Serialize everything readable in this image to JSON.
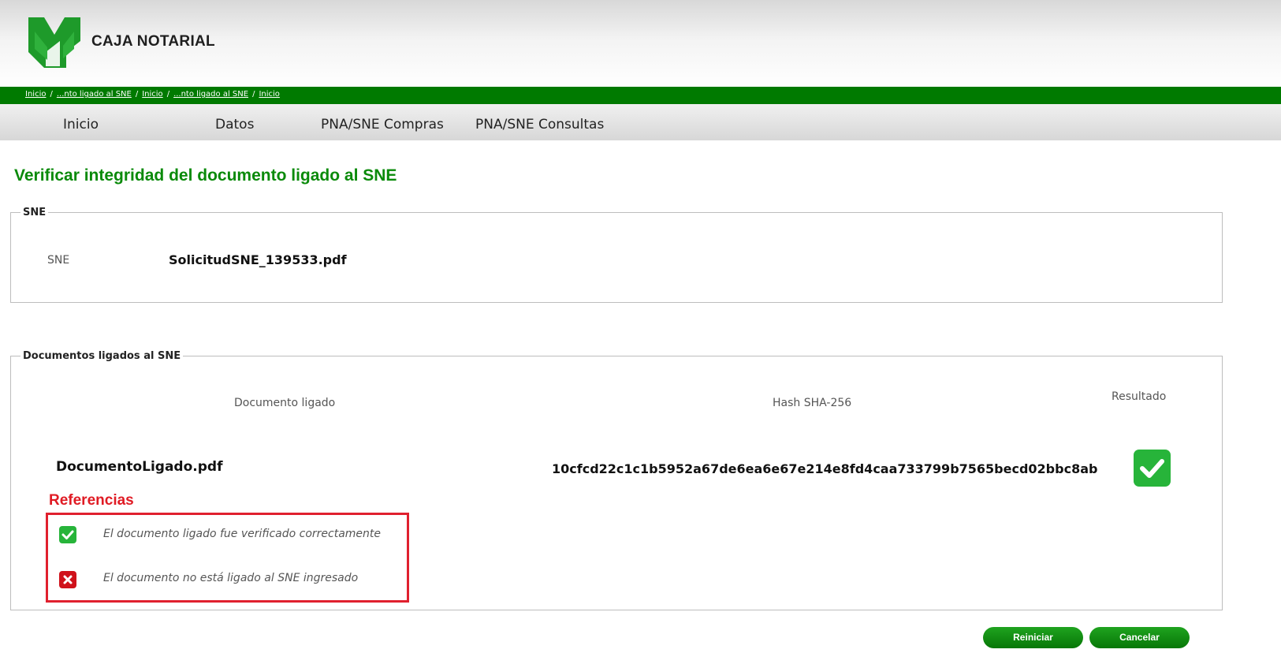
{
  "brand": {
    "name": "CAJA NOTARIAL",
    "logo_icon": "caja-notarial-logo",
    "color": "#0a8a0a"
  },
  "breadcrumb": [
    {
      "label": "Inicio"
    },
    {
      "label": "...nto ligado al SNE"
    },
    {
      "label": "Inicio"
    },
    {
      "label": "...nto ligado al SNE"
    },
    {
      "label": "Inicio"
    }
  ],
  "breadcrumb_separator": "/",
  "nav": [
    {
      "label": "Inicio"
    },
    {
      "label": "Datos"
    },
    {
      "label": "PNA/SNE Compras"
    },
    {
      "label": "PNA/SNE Consultas"
    }
  ],
  "page_title": "Verificar integridad del documento ligado al SNE",
  "sne_section": {
    "legend": "SNE",
    "label": "SNE",
    "value": "SolicitudSNE_139533.pdf"
  },
  "docs_section": {
    "legend": "Documentos ligados al SNE",
    "columns": [
      "Documento ligado",
      "Hash SHA-256",
      "Resultado"
    ],
    "rows": [
      {
        "document": "DocumentoLigado.pdf",
        "hash": "10cfcd22c1c1b5952a67de6ea6e67e214e8fd4caa733799b7565becd02bbc8ab",
        "result_icon": "check-icon",
        "result_color": "#27b43a"
      }
    ]
  },
  "references": {
    "title": "Referencias",
    "items": [
      {
        "icon": "check-icon",
        "color": "#27b43a",
        "text": "El documento ligado fue verificado correctamente"
      },
      {
        "icon": "close-icon",
        "color": "#d0121b",
        "text": "El documento no está ligado al SNE ingresado"
      }
    ]
  },
  "buttons": {
    "reset": "Reiniciar",
    "cancel": "Cancelar"
  }
}
